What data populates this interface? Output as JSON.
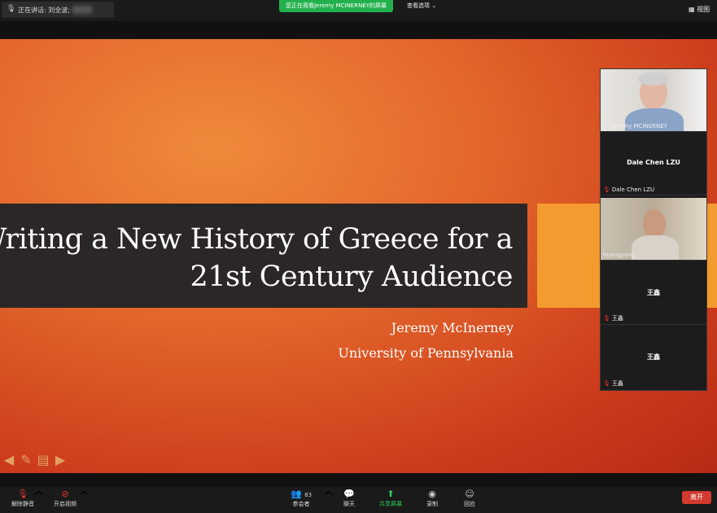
{
  "topbar": {
    "speaker_label": "正在讲话: 刘全波;",
    "share_banner": "您正在观看Jeremy MCINERNEY的屏幕",
    "view_options": "查看选项",
    "view_right": "视图"
  },
  "slide": {
    "title_line1": "Writing a New History of Greece for a",
    "title_line2": "21st Century Audience",
    "author": "Jeremy McInerney",
    "university": "University of Pennsylvania"
  },
  "participants": [
    {
      "label": "Jeremy MCINERNEY",
      "video": true
    },
    {
      "center_name": "Dale Chen LZU",
      "label": "Dale Chen LZU",
      "muted": true
    },
    {
      "label": "huangyang",
      "video": true
    },
    {
      "center_name": "王鑫",
      "label": "王鑫",
      "muted": true
    },
    {
      "center_name": "王鑫",
      "label": "王鑫",
      "muted": true
    }
  ],
  "toolbar": {
    "unmute": "解除静音",
    "start_video": "开启视频",
    "participants": "参会者",
    "participants_count": "83",
    "chat": "聊天",
    "share_screen": "共享屏幕",
    "record": "录制",
    "reactions": "回应",
    "leave": "离开"
  },
  "colors": {
    "share_banner_green": "#23b14d",
    "leave_red": "#d13a2e",
    "slide_orange": "#e2642a",
    "title_band": "#2b2726"
  }
}
